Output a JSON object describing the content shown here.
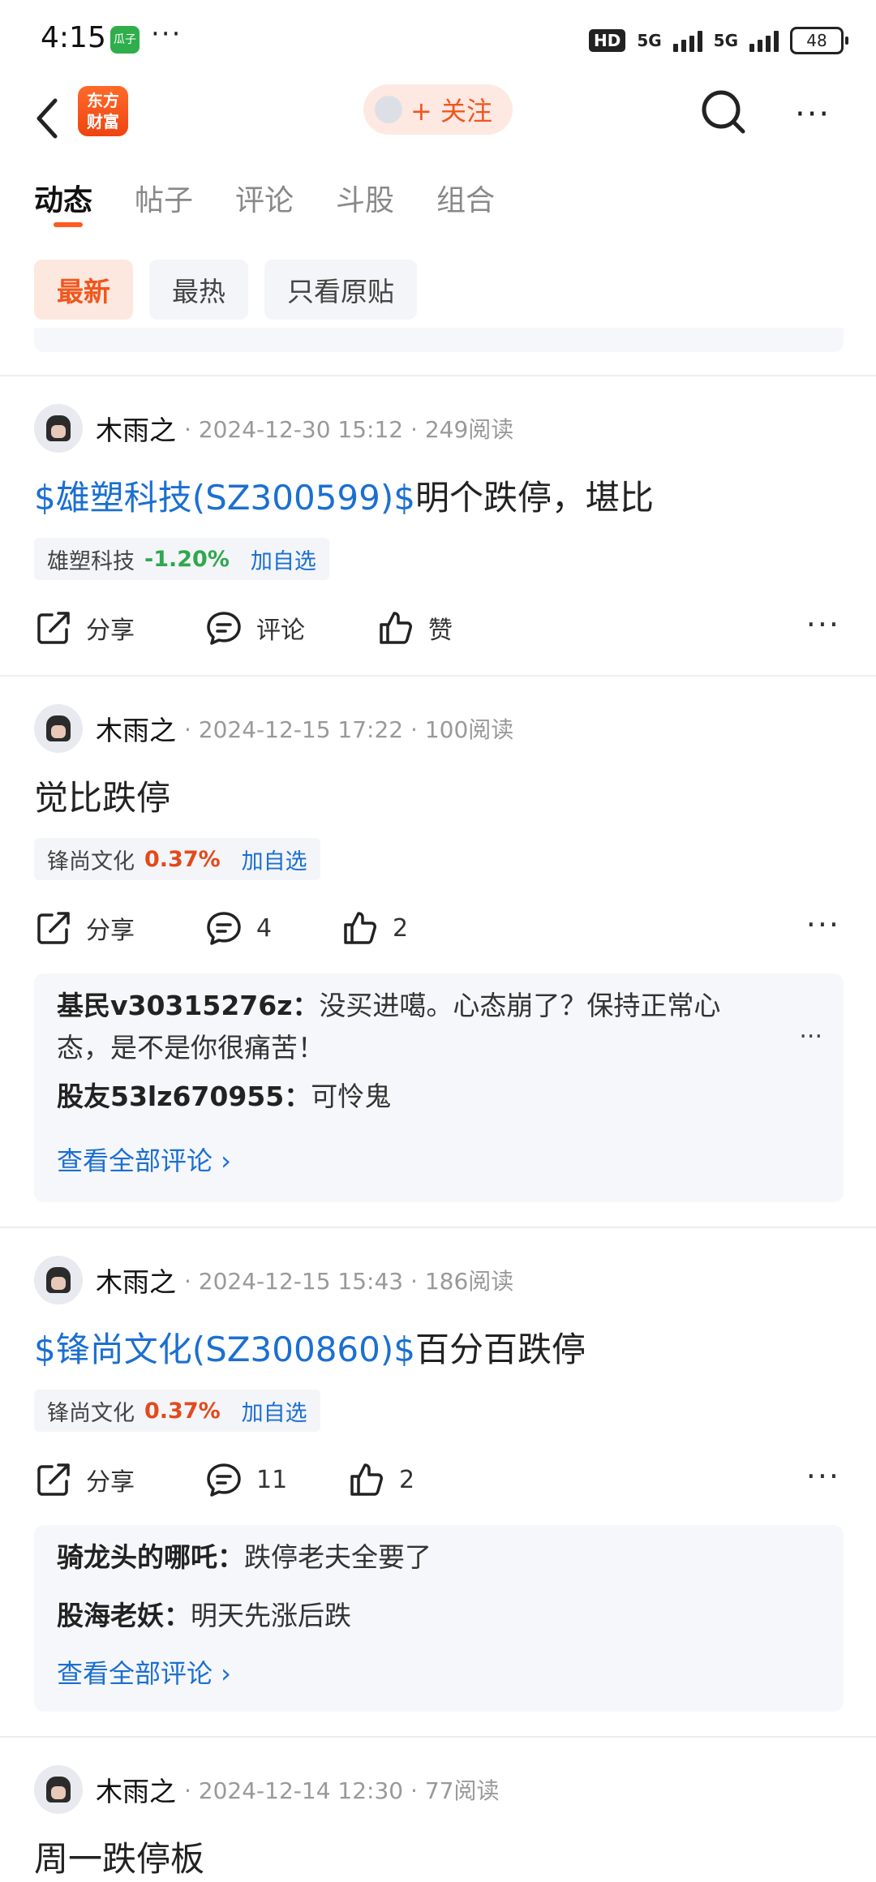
{
  "status_bar": {
    "time": "4:15",
    "app_badge": "瓜子",
    "dots": "···",
    "hd": "HD",
    "net1": "5G",
    "net2": "5G",
    "battery": "48"
  },
  "nav": {
    "logo_line1": "东方",
    "logo_line2": "财富",
    "follow_label": "+ 关注",
    "more": "···"
  },
  "tabs": [
    "动态",
    "帖子",
    "评论",
    "斗股",
    "组合"
  ],
  "filters": [
    "最新",
    "最热",
    "只看原贴"
  ],
  "colors": {
    "accent": "#f0561d",
    "link": "#1b6fd1",
    "down": "#2fa84f",
    "up": "#e24a1c"
  },
  "posts": [
    {
      "author": "木雨之",
      "info": "· 2024-12-30 15:12 · 249阅读",
      "title_link": "$雄塑科技(SZ300599)$",
      "title_text": "明个跌停，堪比",
      "stock": {
        "name": "雄塑科技",
        "pct": "-1.20%",
        "add": "加自选"
      },
      "share": "分享",
      "comment": "评论",
      "like": "赞",
      "more": "···"
    },
    {
      "author": "木雨之",
      "info": "· 2024-12-15 17:22 · 100阅读",
      "title_link": "",
      "title_text": "觉比跌停",
      "stock": {
        "name": "锋尚文化",
        "pct": "0.37%",
        "add": "加自选"
      },
      "share": "分享",
      "comment": "4",
      "like": "2",
      "more": "···",
      "comments": [
        {
          "user": "基民v30315276z：",
          "text": "没买进噶。心态崩了？保持正常心",
          "text2": "态，是不是你很痛苦！"
        },
        {
          "user": "股友53lz670955：",
          "text": "可怜鬼"
        }
      ],
      "comment_more": "...",
      "view_all": "查看全部评论 ›"
    },
    {
      "author": "木雨之",
      "info": "· 2024-12-15 15:43 · 186阅读",
      "title_link": "$锋尚文化(SZ300860)$",
      "title_text": "百分百跌停",
      "stock": {
        "name": "锋尚文化",
        "pct": "0.37%",
        "add": "加自选"
      },
      "share": "分享",
      "comment": "11",
      "like": "2",
      "more": "···",
      "comments": [
        {
          "user": "骑龙头的哪吒：",
          "text": "跌停老夫全要了"
        },
        {
          "user": "股海老妖：",
          "text": "明天先涨后跌"
        }
      ],
      "view_all": "查看全部评论 ›"
    },
    {
      "author": "木雨之",
      "info": "· 2024-12-14 12:30 · 77阅读",
      "title_text": "周一跌停板"
    }
  ]
}
